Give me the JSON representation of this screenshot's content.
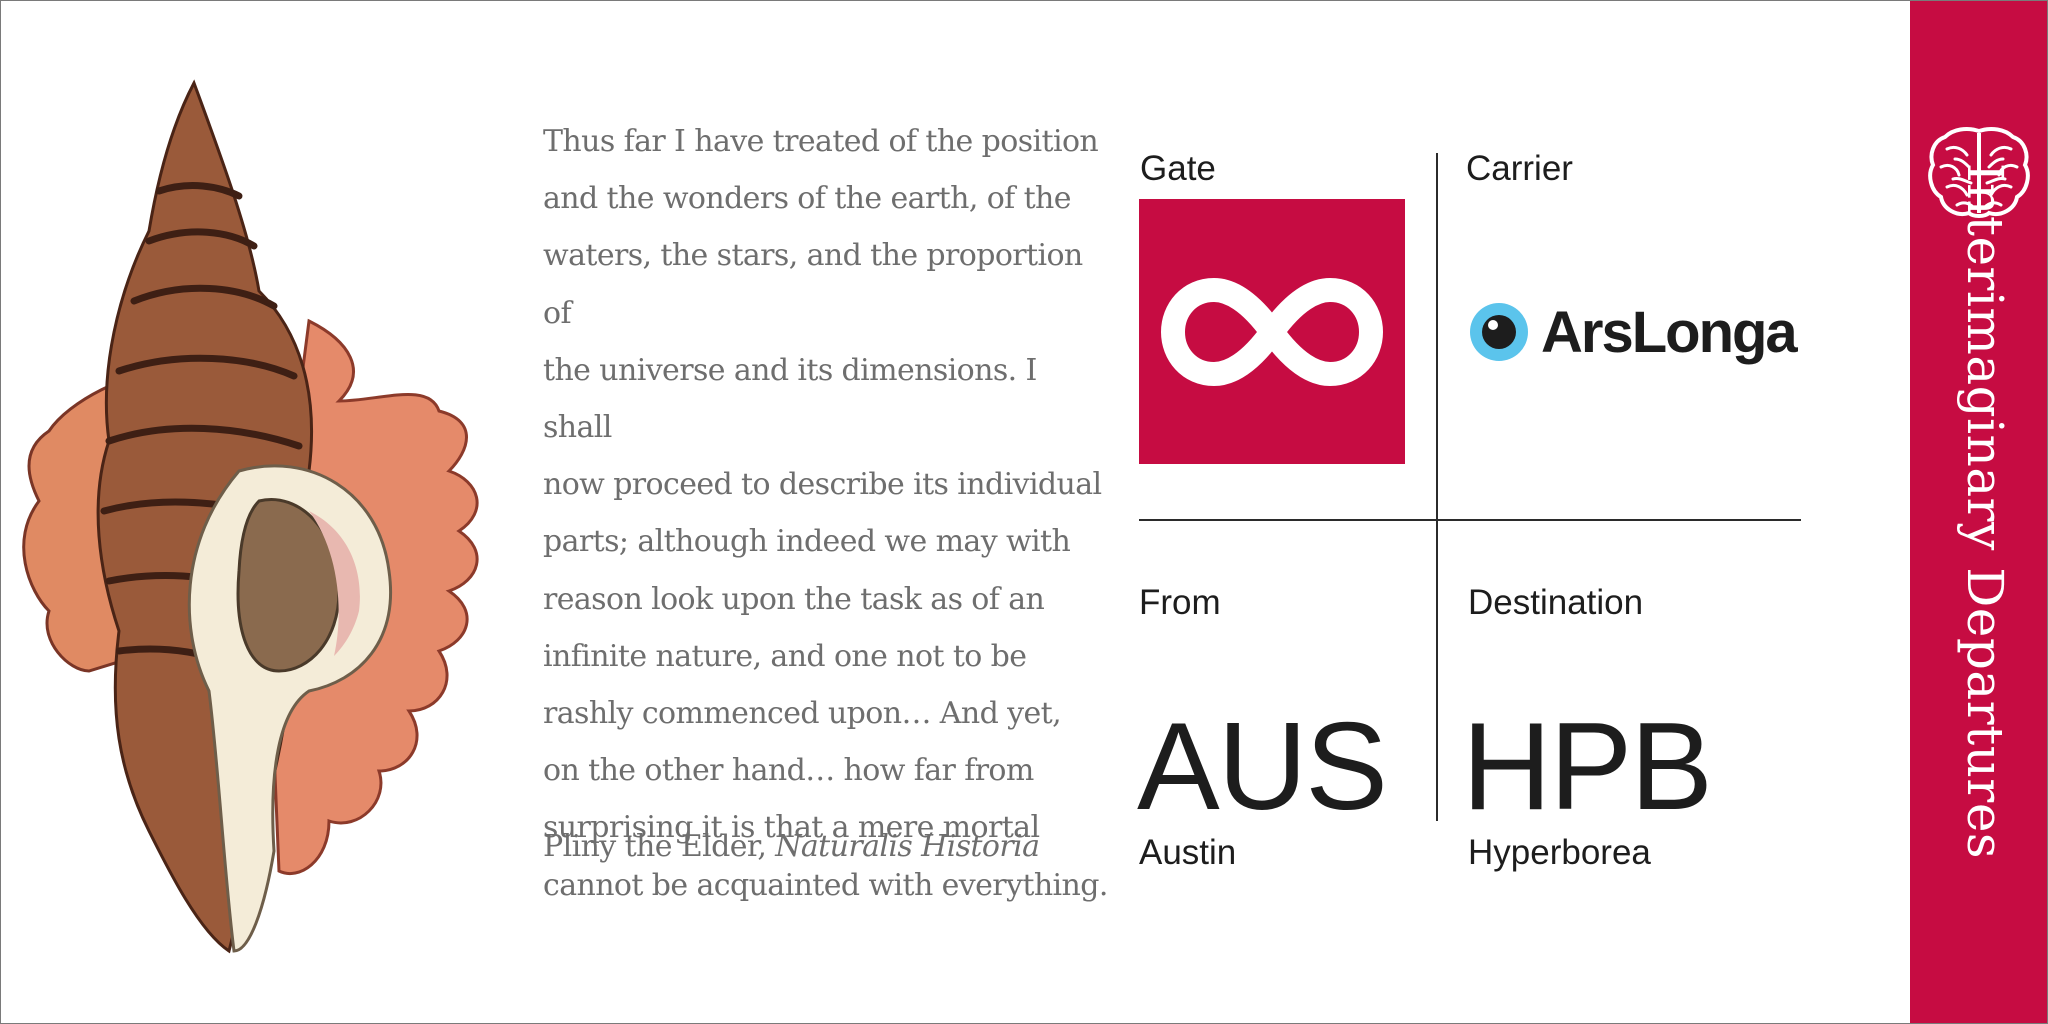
{
  "quote": {
    "lines": [
      "Thus far I have treated of the position",
      "and the wonders of the earth, of the",
      "waters, the stars, and the proportion of",
      "the universe and its dimensions. I shall",
      "now proceed to describe its individual",
      "parts; although indeed we may with",
      "reason look upon the task as of an",
      "infinite nature, and one not to be",
      "rashly commenced upon… And yet,",
      "on the other hand… how far from",
      "surprising it is that a mere mortal",
      "cannot be acquainted with everything."
    ],
    "author": "Pliny the Elder,",
    "work": "Naturalis Historia"
  },
  "gate": {
    "label": "Gate",
    "icon": "infinity-icon"
  },
  "carrier": {
    "label": "Carrier",
    "name": "ArsLonga",
    "icon": "eye-icon"
  },
  "from": {
    "label": "From",
    "code": "AUS",
    "city": "Austin"
  },
  "destination": {
    "label": "Destination",
    "code": "HPB",
    "city": "Hyperborea"
  },
  "brand": {
    "title": "Interimaginary Departures",
    "icon": "brain-icon"
  },
  "colors": {
    "accent": "#c60c42",
    "text": "#1d1d1d",
    "quote_text": "#6e6e6e",
    "eye_blue": "#5bc4ec"
  }
}
